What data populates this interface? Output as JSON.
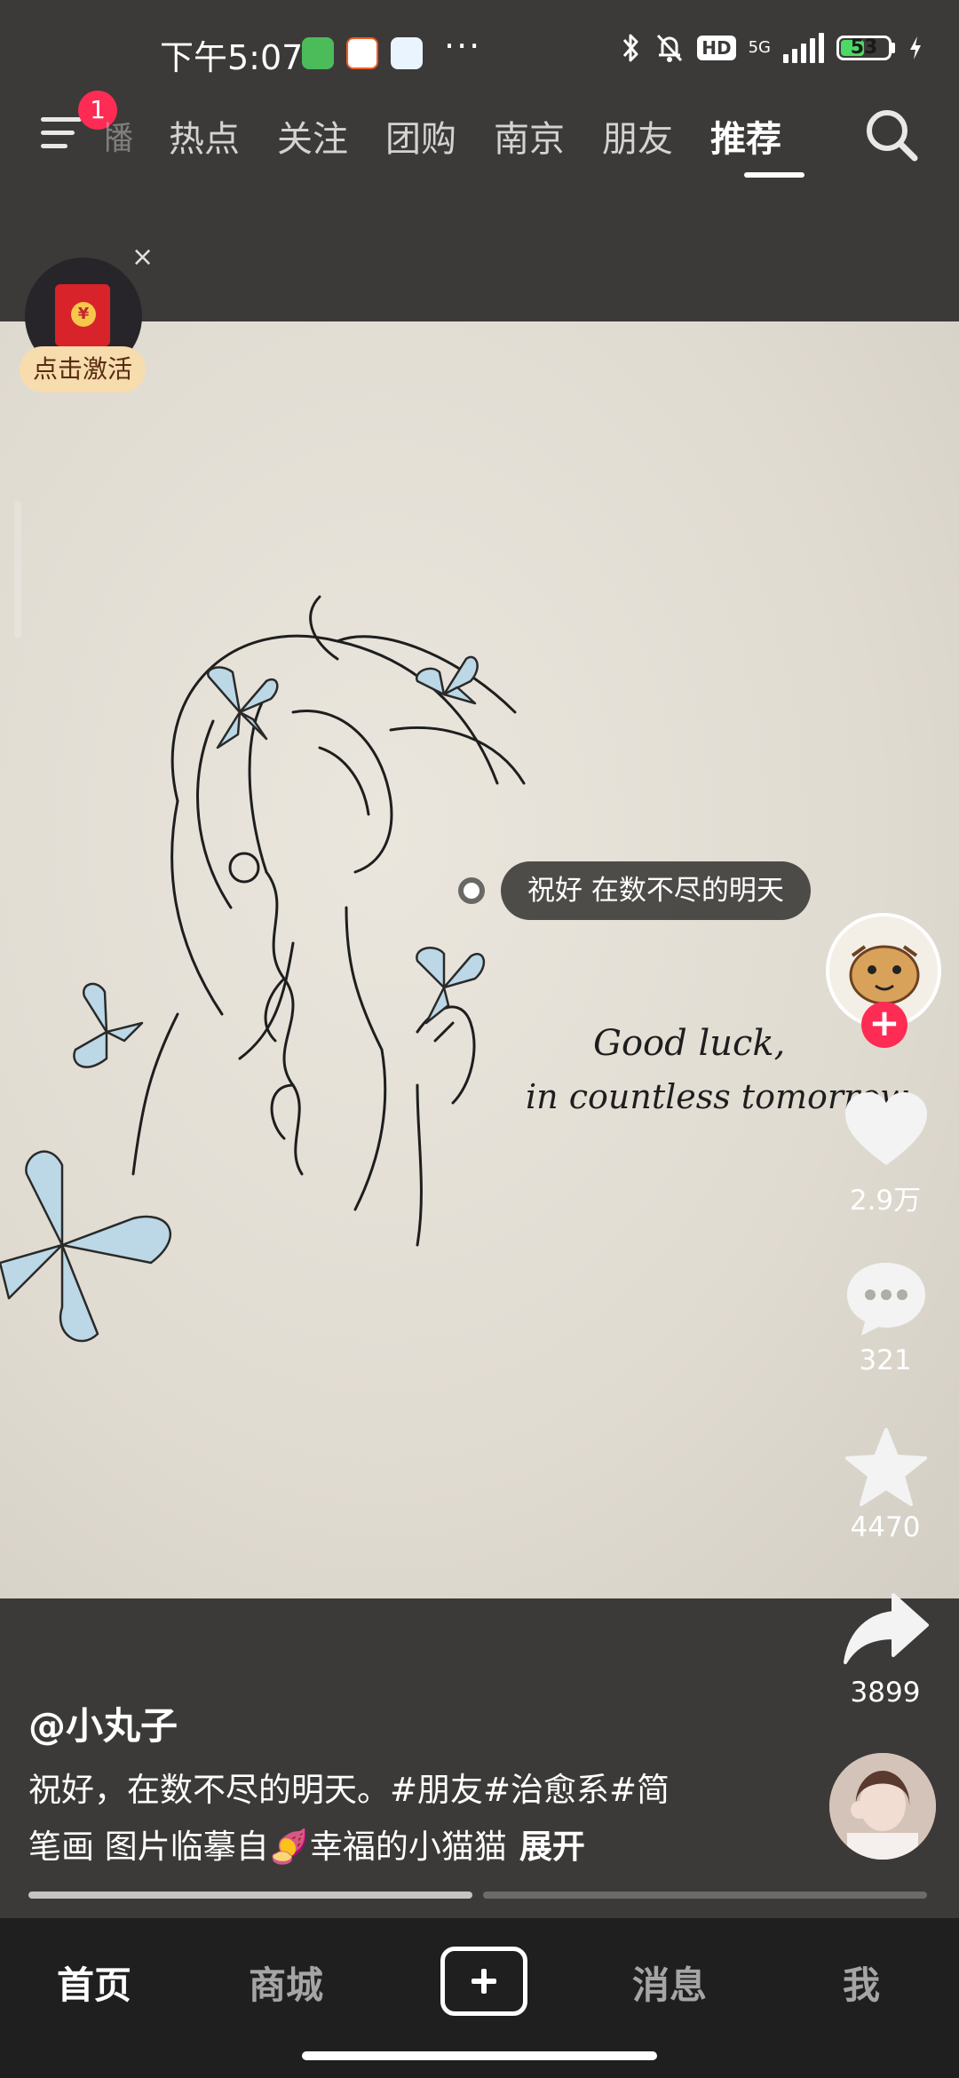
{
  "status_bar": {
    "time": "下午5:07",
    "app_icons": [
      "wechat-icon",
      "58-app-icon",
      "cloud-app-icon"
    ],
    "more": "···",
    "badges": {
      "hd": "HD",
      "network": "5G"
    },
    "battery": {
      "level_percent": 53,
      "label": "53",
      "charging": true
    }
  },
  "top_nav": {
    "menu_badge": "1",
    "partial_tab": "直播",
    "tabs": [
      {
        "label": "热点"
      },
      {
        "label": "关注"
      },
      {
        "label": "团购"
      },
      {
        "label": "南京"
      },
      {
        "label": "朋友"
      },
      {
        "label": "推荐",
        "active": true
      }
    ]
  },
  "red_packet": {
    "label": "点击激活",
    "close": "×",
    "coin_glyph": "¥"
  },
  "video": {
    "caption_tag": "祝好 在数不尽的明天",
    "handwriting_line1": "Good luck,",
    "handwriting_line2": "in countless tomorrow."
  },
  "actions": {
    "follow": "+",
    "likes": "2.9万",
    "comments": "321",
    "favorites": "4470",
    "shares": "3899"
  },
  "post": {
    "author": "@小丸子",
    "description_line1": "祝好，在数不尽的明天。#朋友#治愈系#简",
    "description_line2": "笔画 图片临摹自🍠幸福的小猫猫",
    "expand": "展开"
  },
  "tabbar": {
    "home": "首页",
    "mall": "商城",
    "messages": "消息",
    "me": "我"
  },
  "colors": {
    "accent_red": "#fe2c55",
    "background": "#3b3a38",
    "paper": "#e6e2d9",
    "butterfly_blue": "#bcd8e6"
  }
}
